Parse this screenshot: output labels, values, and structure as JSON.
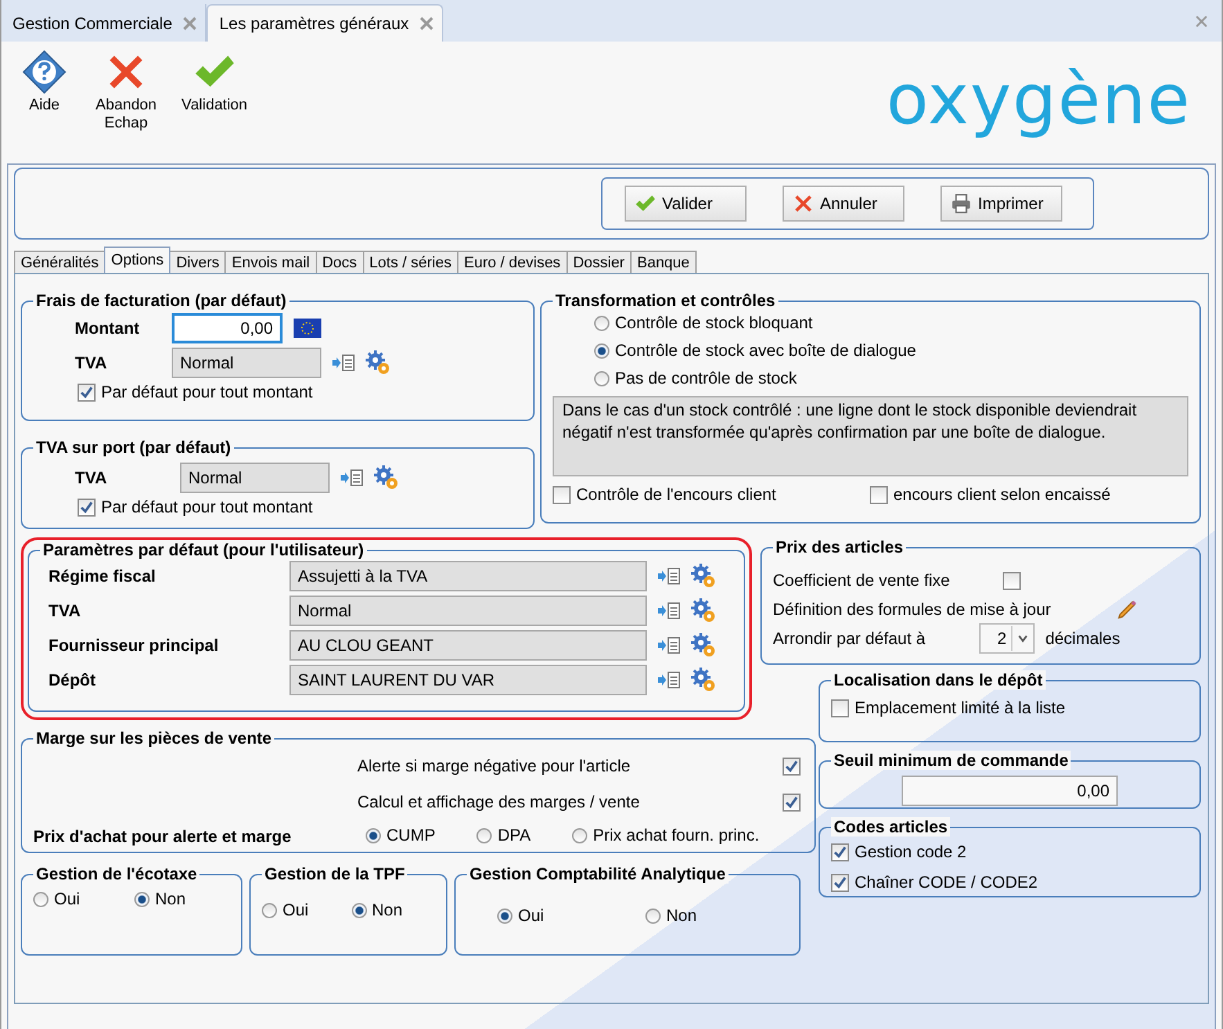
{
  "doc_tabs": [
    {
      "label": "Gestion Commerciale",
      "selected": false
    },
    {
      "label": "Les paramètres généraux",
      "selected": true
    }
  ],
  "toolbar": [
    {
      "kind": "help",
      "label": "Aide"
    },
    {
      "kind": "cancel",
      "label": "Abandon\nEchap"
    },
    {
      "kind": "ok",
      "label": "Validation"
    }
  ],
  "logo": "oxygène",
  "actions": [
    {
      "kind": "ok",
      "label": "Valider"
    },
    {
      "kind": "cancel",
      "label": "Annuler"
    },
    {
      "kind": "print",
      "label": "Imprimer"
    }
  ],
  "tabs": [
    {
      "label": "Généralités",
      "selected": false
    },
    {
      "label": "Options",
      "selected": true
    },
    {
      "label": "Divers",
      "selected": false
    },
    {
      "label": "Envois mail",
      "selected": false
    },
    {
      "label": "Docs",
      "selected": false
    },
    {
      "label": "Lots / séries",
      "selected": false
    },
    {
      "label": "Euro / devises",
      "selected": false
    },
    {
      "label": "Dossier",
      "selected": false
    },
    {
      "label": "Banque",
      "selected": false
    }
  ],
  "frais": {
    "title": "Frais de facturation (par défaut)",
    "montant": {
      "label": "Montant",
      "value": "0,00"
    },
    "tva": {
      "label": "TVA",
      "value": "Normal"
    },
    "check": {
      "label": "Par défaut pour tout montant",
      "checked": true
    }
  },
  "tva_port": {
    "title": "TVA sur port (par défaut)",
    "tva": {
      "label": "TVA",
      "value": "Normal"
    },
    "check": {
      "label": "Par défaut pour tout montant",
      "checked": true
    }
  },
  "transformation": {
    "title": "Transformation et contrôles",
    "options": [
      {
        "label": "Contrôle de stock bloquant",
        "selected": false
      },
      {
        "label": "Contrôle de stock avec boîte de dialogue",
        "selected": true
      },
      {
        "label": "Pas de contrôle de stock",
        "selected": false
      }
    ],
    "note": "Dans le cas d'un stock contrôlé : une ligne dont le stock disponible deviendrait négatif n'est transformée qu'après confirmation par une boîte de dialogue.",
    "checks": [
      {
        "label": "Contrôle de l'encours client",
        "checked": false
      },
      {
        "label": "encours client selon encaissé",
        "checked": false
      }
    ]
  },
  "user_defaults": {
    "title": "Paramètres par défaut (pour l'utilisateur)",
    "highlighted": true,
    "rows": [
      {
        "label": "Régime fiscal",
        "value": "Assujetti à la TVA"
      },
      {
        "label": "TVA",
        "value": "Normal"
      },
      {
        "label": "Fournisseur principal",
        "value": "AU CLOU GEANT"
      },
      {
        "label": "Dépôt",
        "value": "SAINT LAURENT DU VAR"
      }
    ]
  },
  "prix": {
    "title": "Prix des articles",
    "coef": {
      "label": "Coefficient de vente fixe",
      "checked": false
    },
    "formules": "Définition des formules de mise à jour",
    "arrondir": {
      "label": "Arrondir par défaut à",
      "value": "2",
      "suffix": "décimales"
    }
  },
  "marge": {
    "title": "Marge sur les pièces de vente",
    "checks": [
      {
        "label": "Alerte si marge négative pour l'article",
        "checked": true
      },
      {
        "label": "Calcul et affichage des marges / vente",
        "checked": true
      }
    ],
    "prix_achat": {
      "label": "Prix d'achat pour alerte et marge",
      "options": [
        {
          "label": "CUMP",
          "selected": true
        },
        {
          "label": "DPA",
          "selected": false
        },
        {
          "label": "Prix achat fourn. princ.",
          "selected": false
        }
      ]
    }
  },
  "small_groups": [
    {
      "title": "Gestion de l'écotaxe",
      "options": [
        {
          "label": "Oui",
          "selected": false
        },
        {
          "label": "Non",
          "selected": true
        }
      ]
    },
    {
      "title": "Gestion de la TPF",
      "options": [
        {
          "label": "Oui",
          "selected": false
        },
        {
          "label": "Non",
          "selected": true
        }
      ]
    },
    {
      "title": "Gestion Comptabilité Analytique",
      "options": [
        {
          "label": "Oui",
          "selected": true
        },
        {
          "label": "Non",
          "selected": false
        }
      ]
    }
  ],
  "localisation": {
    "title": "Localisation dans le dépôt",
    "check": {
      "label": "Emplacement limité à la liste",
      "checked": false
    }
  },
  "seuil": {
    "title": "Seuil minimum de commande",
    "value": "0,00"
  },
  "codes": {
    "title": "Codes articles",
    "checks": [
      {
        "label": "Gestion code 2",
        "checked": true
      },
      {
        "label": "Chaîner CODE / CODE2",
        "checked": true
      }
    ]
  }
}
